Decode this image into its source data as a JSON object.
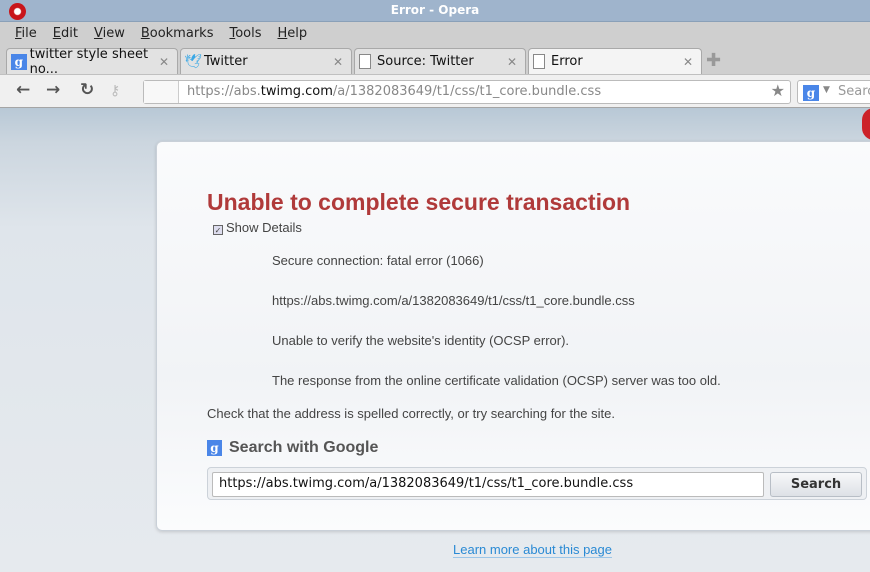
{
  "window": {
    "title": "Error - Opera"
  },
  "menu": [
    "File",
    "Edit",
    "View",
    "Bookmarks",
    "Tools",
    "Help"
  ],
  "tabs": [
    {
      "label": "twitter style sheet no...",
      "icon": "google-icon"
    },
    {
      "label": "Twitter",
      "icon": "twitter-bird-icon"
    },
    {
      "label": "Source: Twitter",
      "icon": "page-icon"
    },
    {
      "label": "Error",
      "icon": "page-icon",
      "active": true
    }
  ],
  "address": {
    "prefix": "https://abs.",
    "domain": "twimg.com",
    "path": "/a/1382083649/t1/css/t1_core.bundle.css"
  },
  "search_bar": {
    "placeholder": "Search",
    "engine": "google-icon"
  },
  "error": {
    "title": "Unable to complete secure transaction",
    "show_details": "Show Details",
    "details": [
      "Secure connection: fatal error (1066)",
      "https://abs.twimg.com/a/1382083649/t1/css/t1_core.bundle.css",
      "Unable to verify the website's identity (OCSP error).",
      "The response from the online certificate validation (OCSP) server was too old."
    ],
    "hint": "Check that the address is spelled correctly, or try searching for the site.",
    "search_heading": "Search with Google",
    "search_value": "https://abs.twimg.com/a/1382083649/t1/css/t1_core.bundle.css",
    "search_button": "Search",
    "learn_more": "Learn more about this page"
  },
  "colors": {
    "title": "#b03a3a",
    "link": "#2a8ad4",
    "titlebar": "#9fb4cc"
  }
}
